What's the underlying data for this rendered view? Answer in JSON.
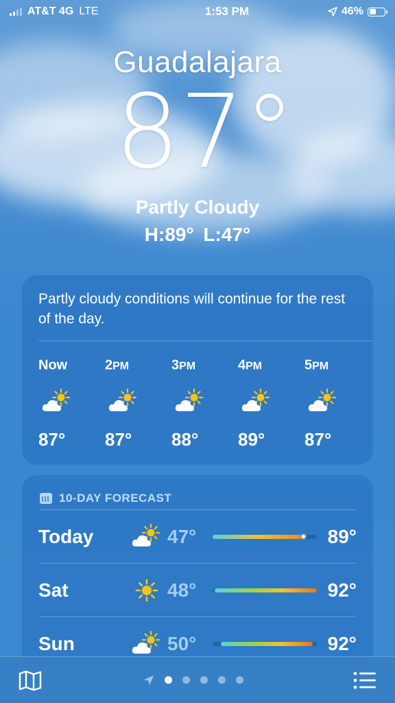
{
  "status_bar": {
    "carrier": "AT&T 4G",
    "network": "LTE",
    "time": "1:53 PM",
    "battery": "46%",
    "battery_level": 0.46,
    "signal_bars_filled": 2,
    "signal_bars_total": 4
  },
  "location": {
    "city": "Guadalajara",
    "temperature": "87°",
    "condition": "Partly Cloudy",
    "hi_lo": "H:89°  L:47°"
  },
  "hourly": {
    "summary": "Partly cloudy conditions will continue for the rest of the day.",
    "hours": [
      {
        "time": "Now",
        "ampm": "",
        "icon": "partly-sunny-icon",
        "temp": "87°"
      },
      {
        "time": "2",
        "ampm": "PM",
        "icon": "partly-sunny-icon",
        "temp": "87°"
      },
      {
        "time": "3",
        "ampm": "PM",
        "icon": "partly-sunny-icon",
        "temp": "88°"
      },
      {
        "time": "4",
        "ampm": "PM",
        "icon": "partly-sunny-icon",
        "temp": "89°"
      },
      {
        "time": "5",
        "ampm": "PM",
        "icon": "partly-sunny-icon",
        "temp": "87°"
      }
    ]
  },
  "forecast": {
    "header": "10-DAY FORECAST",
    "days": [
      {
        "day": "Today",
        "icon": "partly-sunny-icon",
        "low": "47°",
        "high": "89°",
        "bar_start": 0.0,
        "bar_end": 0.87,
        "current": 0.87,
        "gradient": [
          "#5ad1dc",
          "#f4c22b",
          "#f08a24"
        ]
      },
      {
        "day": "Sat",
        "icon": "sun-icon",
        "low": "48°",
        "high": "92°",
        "bar_start": 0.02,
        "bar_end": 1.0,
        "current": null,
        "gradient": [
          "#5ad1dc",
          "#9ad24a",
          "#f4c22b",
          "#f07024"
        ]
      },
      {
        "day": "Sun",
        "icon": "partly-sunny-icon",
        "low": "50°",
        "high": "92°",
        "bar_start": 0.08,
        "bar_end": 0.96,
        "current": null,
        "gradient": [
          "#5ad1dc",
          "#9ad24a",
          "#f4c22b",
          "#f07024"
        ]
      }
    ]
  },
  "bottom_bar": {
    "map_icon": "map-icon",
    "location_icon": "location-arrow-icon",
    "pages": 5,
    "active_page": 0,
    "list_icon": "list-icon"
  },
  "colors": {
    "sun": "#f5c518",
    "cloud": "#ffffff"
  }
}
